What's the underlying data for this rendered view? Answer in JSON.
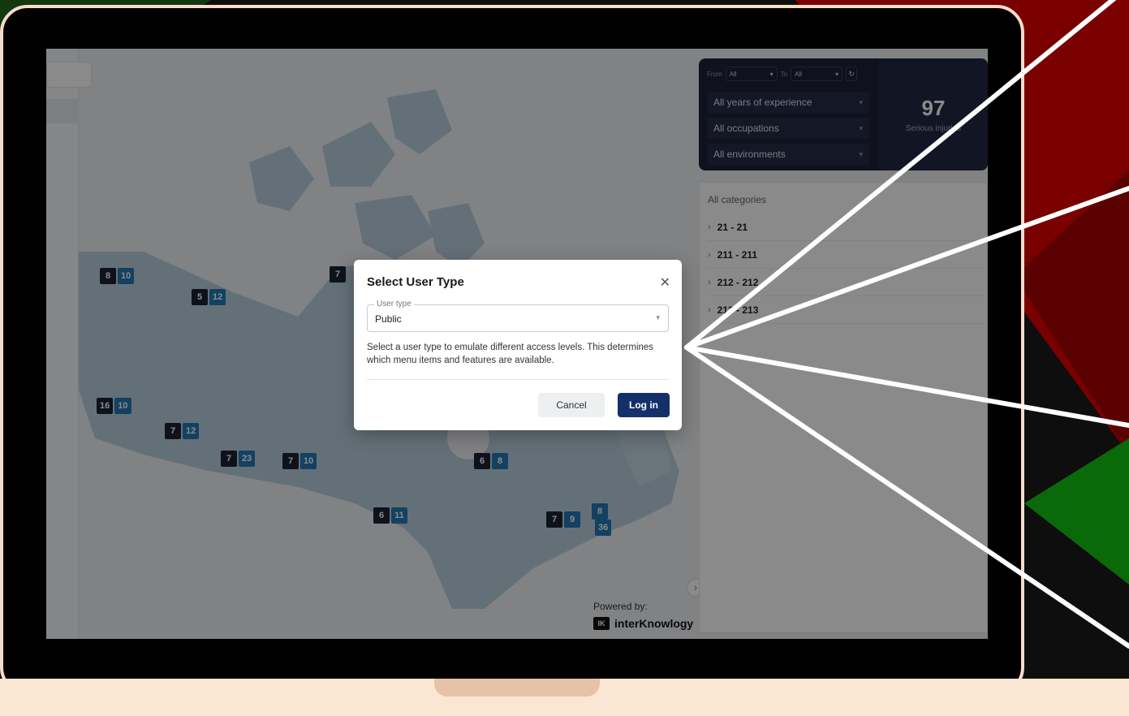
{
  "colors": {
    "accent_dark_navy": "#1c2036",
    "login_button": "#13306b",
    "map_blue": "#2378b5",
    "badge_dark": "#1e2233",
    "laptop_frame": "#f7dcc8",
    "bg_red": "#7a0000",
    "bg_green": "#0a7a0a"
  },
  "filters": {
    "from_label": "From",
    "from_value": "All",
    "to_label": "To",
    "to_value": "All",
    "refresh_icon": "refresh-icon",
    "experience": "All years of experience",
    "occupations": "All occupations",
    "environments": "All environments"
  },
  "stat": {
    "value": "97",
    "label": "Serious injuries"
  },
  "categories": {
    "title": "All categories",
    "items": [
      "21 - 21",
      "211 - 211",
      "212 - 212",
      "213 - 213"
    ]
  },
  "map_badges": [
    {
      "dark": "8",
      "blue": "10"
    },
    {
      "dark": "5",
      "blue": "12"
    },
    {
      "dark": "7",
      "blue": ""
    },
    {
      "dark": "16",
      "blue": "10"
    },
    {
      "dark": "7",
      "blue": "12"
    },
    {
      "dark": "7",
      "blue": "23"
    },
    {
      "dark": "7",
      "blue": "10"
    },
    {
      "dark": "6",
      "blue": "8"
    },
    {
      "dark": "6",
      "blue": "11"
    },
    {
      "dark": "7",
      "blue": "9"
    },
    {
      "dark": "",
      "blue": "8"
    },
    {
      "dark": "",
      "blue": "36"
    }
  ],
  "powered_by": {
    "label": "Powered by:",
    "brand_mark": "IK",
    "brand_name": "interKnowlogy"
  },
  "modal": {
    "title": "Select User Type",
    "close_icon": "close-icon",
    "field_label": "User type",
    "field_value": "Public",
    "description": "Select a user type to emulate different access levels. This determines which menu items and features are available.",
    "cancel_label": "Cancel",
    "login_label": "Log in"
  }
}
